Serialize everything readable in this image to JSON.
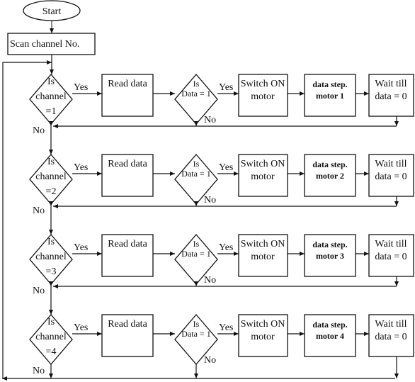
{
  "start_label": "Start",
  "scan_label": "Scan channel No.",
  "yes_label": "Yes",
  "no_label": "No",
  "rows": [
    {
      "channel_q": [
        "Is",
        "channel",
        "=1"
      ],
      "read": "Read data",
      "data_q": [
        "Is",
        "Data = 1"
      ],
      "switch": [
        "Switch ON",
        "motor"
      ],
      "step": [
        "data step.",
        "motor 1"
      ],
      "wait": [
        "Wait till",
        "data = 0"
      ]
    },
    {
      "channel_q": [
        "Is",
        "channel",
        "=2"
      ],
      "read": "Read data",
      "data_q": [
        "Is",
        "Data = 1"
      ],
      "switch": [
        "Switch ON",
        "motor"
      ],
      "step": [
        "data step.",
        "motor 2"
      ],
      "wait": [
        "Wait till",
        "data = 0"
      ]
    },
    {
      "channel_q": [
        "Is",
        "channel",
        "=3"
      ],
      "read": "Read data",
      "data_q": [
        "Is",
        "Data = 1"
      ],
      "switch": [
        "Switch ON",
        "motor"
      ],
      "step": [
        "data step.",
        "motor 3"
      ],
      "wait": [
        "Wait till",
        "data = 0"
      ]
    },
    {
      "channel_q": [
        "Is",
        "channel",
        "=4"
      ],
      "read": "Read data",
      "data_q": [
        "Is",
        "Data = 1"
      ],
      "switch": [
        "Switch ON",
        "motor"
      ],
      "step": [
        "data step.",
        "motor 4"
      ],
      "wait": [
        "Wait till",
        "data = 0"
      ]
    }
  ]
}
